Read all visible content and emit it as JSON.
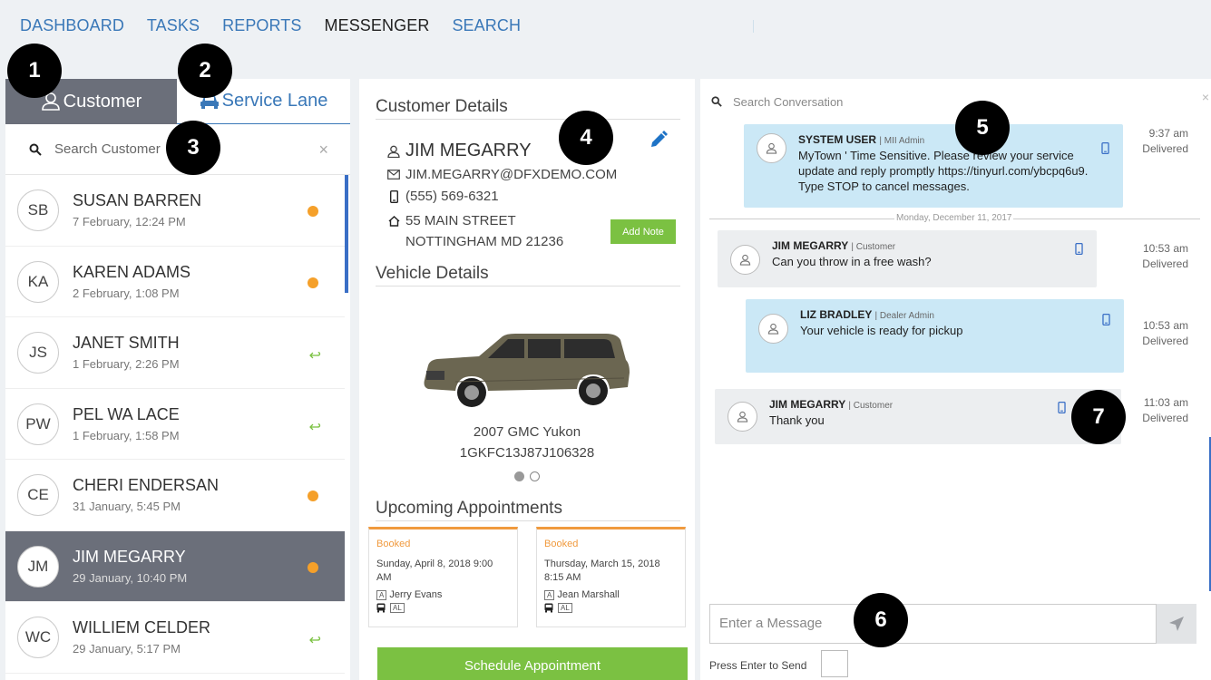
{
  "nav": {
    "items": [
      "DASHBOARD",
      "TASKS",
      "REPORTS",
      "MESSENGER",
      "SEARCH"
    ],
    "active": "MESSENGER"
  },
  "tabs": {
    "customer": "Customer",
    "service_lane": "Service Lane"
  },
  "customer_search": {
    "placeholder": "Search Customer",
    "clear": "×"
  },
  "customers": [
    {
      "initials": "SB",
      "name": "SUSAN BARREN",
      "date": "7 February, 12:24 PM",
      "status": "unread"
    },
    {
      "initials": "KA",
      "name": "KAREN ADAMS",
      "date": "2 February, 1:08 PM",
      "status": "unread"
    },
    {
      "initials": "JS",
      "name": "JANET SMITH",
      "date": "1 February, 2:26 PM",
      "status": "replied"
    },
    {
      "initials": "PW",
      "name": "PEL WA LACE",
      "date": "1 February, 1:58 PM",
      "status": "replied"
    },
    {
      "initials": "CE",
      "name": "CHERI ENDERSAN",
      "date": "31 January, 5:45 PM",
      "status": "unread"
    },
    {
      "initials": "JM",
      "name": "JIM MEGARRY",
      "date": "29 January, 10:40 PM",
      "status": "unread",
      "active": true
    },
    {
      "initials": "WC",
      "name": "WILLIEM CELDER",
      "date": "29 January, 5:17 PM",
      "status": "replied"
    }
  ],
  "customer_details": {
    "title": "Customer Details",
    "name": "JIM MEGARRY",
    "email": "JIM.MEGARRY@DFXDEMO.COM",
    "phone": "(555) 569-6321",
    "address_line1": "55 MAIN STREET",
    "address_line2": "NOTTINGHAM MD 21236",
    "add_note": "Add Note"
  },
  "vehicle_details": {
    "title": "Vehicle Details",
    "name": "2007 GMC Yukon",
    "vin": "1GKFC13J87J106328"
  },
  "appointments": {
    "title": "Upcoming Appointments",
    "items": [
      {
        "status": "Booked",
        "date": "Sunday, April 8, 2018 9:00 AM",
        "advisor": "Jerry Evans",
        "advisor_tag": "A",
        "transport_tag": "AL"
      },
      {
        "status": "Booked",
        "date": "Thursday, March 15, 2018 8:15 AM",
        "advisor": "Jean Marshall",
        "advisor_tag": "A",
        "transport_tag": "AL"
      }
    ],
    "schedule_button": "Schedule Appointment"
  },
  "conversation": {
    "search_placeholder": "Search Conversation",
    "clear": "×",
    "day_divider": "Monday, December 11, 2017",
    "messages": [
      {
        "from": "SYSTEM USER",
        "role": "| MII Admin",
        "text": "MyTown ' Time Sensitive. Please review your service update and reply promptly https://tinyurl.com/ybcpq6u9. Type STOP to cancel messages.",
        "time": "9:37 am",
        "state": "Delivered"
      },
      {
        "from": "JIM MEGARRY",
        "role": "| Customer",
        "text": "Can you throw in a free wash?",
        "time": "10:53 am",
        "state": "Delivered"
      },
      {
        "from": "LIZ BRADLEY",
        "role": "| Dealer Admin",
        "text": "Your vehicle is ready for pickup",
        "time": "10:53 am",
        "state": "Delivered"
      },
      {
        "from": "JIM MEGARRY",
        "role": "| Customer",
        "text": "Thank you",
        "time": "11:03 am",
        "state": "Delivered"
      }
    ],
    "composer_placeholder": "Enter a Message",
    "enter_label": "Press Enter to Send"
  },
  "callouts": [
    "1",
    "2",
    "3",
    "4",
    "5",
    "6",
    "7"
  ],
  "colors": {
    "accent_blue": "#3a78b8",
    "green": "#7bc142",
    "orange": "#f5a02a",
    "bubble_blue": "#cbe8f6",
    "tab_dark": "#6b6f7a"
  }
}
